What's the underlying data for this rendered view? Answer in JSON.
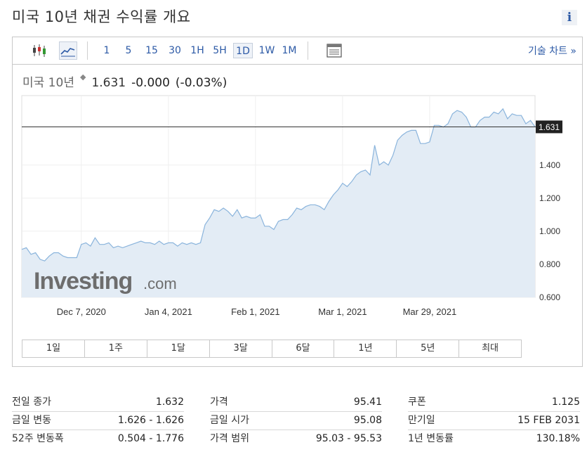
{
  "page": {
    "title": "미국 10년 채권 수익률 개요",
    "info": "i"
  },
  "toolbar": {
    "timeframes": [
      "1",
      "5",
      "15",
      "30",
      "1H",
      "5H",
      "1D",
      "1W",
      "1M"
    ],
    "active_timeframe": "1D",
    "technical_link": "기술 차트 »"
  },
  "quote": {
    "name": "미국 10년",
    "marker": "◆",
    "price": "1.631",
    "change": "-0.000",
    "change_pct": "(-0.03%)"
  },
  "watermark": {
    "brand": "Investing",
    "suffix": ".com"
  },
  "periods": [
    "1일",
    "1주",
    "1달",
    "3달",
    "6달",
    "1년",
    "5년",
    "최대"
  ],
  "colors": {
    "line": "#8ab4dc",
    "area": "#e3ecf5",
    "price_line": "#333333",
    "price_label_bg": "#222222",
    "link": "#2d5aa6"
  },
  "chart_data": {
    "type": "area",
    "title": "",
    "xlabel": "",
    "ylabel": "",
    "ylim": [
      0.6,
      1.82
    ],
    "y_ticks": [
      "0.600",
      "0.800",
      "1.000",
      "1.200",
      "1.400"
    ],
    "x_ticks": [
      "Dec 7, 2020",
      "Jan 4, 2021",
      "Feb 1, 2021",
      "Mar 1, 2021",
      "Mar 29, 2021"
    ],
    "x_tick_index": [
      13,
      32,
      51,
      70,
      89
    ],
    "last_price_label": "1.631",
    "last_price": 1.631,
    "values": [
      0.89,
      0.9,
      0.86,
      0.87,
      0.83,
      0.82,
      0.85,
      0.87,
      0.87,
      0.85,
      0.84,
      0.84,
      0.84,
      0.92,
      0.93,
      0.91,
      0.96,
      0.92,
      0.92,
      0.93,
      0.9,
      0.91,
      0.9,
      0.91,
      0.92,
      0.93,
      0.94,
      0.93,
      0.93,
      0.92,
      0.94,
      0.92,
      0.93,
      0.93,
      0.91,
      0.93,
      0.92,
      0.93,
      0.92,
      0.93,
      1.04,
      1.08,
      1.13,
      1.12,
      1.14,
      1.12,
      1.09,
      1.13,
      1.08,
      1.09,
      1.08,
      1.08,
      1.1,
      1.03,
      1.03,
      1.01,
      1.06,
      1.07,
      1.07,
      1.1,
      1.14,
      1.13,
      1.15,
      1.16,
      1.16,
      1.15,
      1.13,
      1.18,
      1.22,
      1.25,
      1.29,
      1.27,
      1.3,
      1.34,
      1.36,
      1.37,
      1.34,
      1.52,
      1.4,
      1.42,
      1.4,
      1.46,
      1.55,
      1.58,
      1.6,
      1.61,
      1.61,
      1.53,
      1.53,
      1.54,
      1.64,
      1.64,
      1.63,
      1.65,
      1.71,
      1.73,
      1.72,
      1.69,
      1.63,
      1.63,
      1.67,
      1.69,
      1.69,
      1.72,
      1.71,
      1.74,
      1.68,
      1.71,
      1.7,
      1.7,
      1.65,
      1.67,
      1.631
    ]
  },
  "stats": [
    [
      {
        "label": "전일 종가",
        "value": "1.632"
      },
      {
        "label": "금일 변동",
        "value": "1.626 - 1.626"
      },
      {
        "label": "52주 변동폭",
        "value": "0.504 - 1.776"
      }
    ],
    [
      {
        "label": "가격",
        "value": "95.41"
      },
      {
        "label": "금일 시가",
        "value": "95.08"
      },
      {
        "label": "가격 범위",
        "value": "95.03 - 95.53"
      }
    ],
    [
      {
        "label": "쿠폰",
        "value": "1.125"
      },
      {
        "label": "만기일",
        "value": "15 FEB 2031"
      },
      {
        "label": "1년 변동률",
        "value": "130.18%"
      }
    ]
  ]
}
